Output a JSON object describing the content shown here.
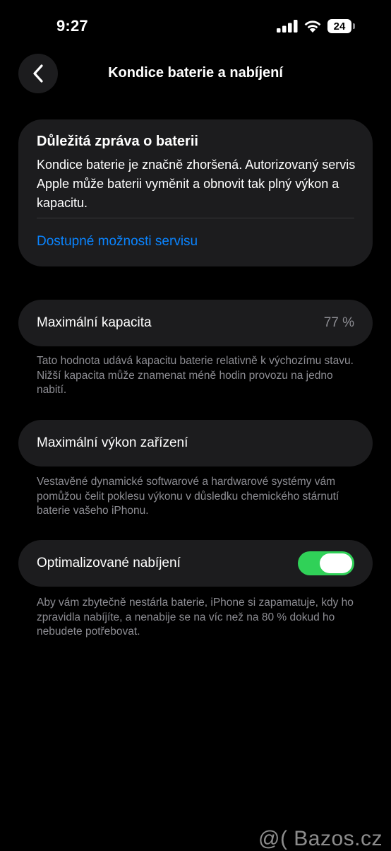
{
  "status_bar": {
    "time": "9:27",
    "battery_level": "24",
    "icons": [
      "signal-icon",
      "wifi-icon",
      "battery-icon"
    ]
  },
  "nav": {
    "back_icon": "chevron-left-icon",
    "title": "Kondice baterie a nabíjení"
  },
  "alert": {
    "title": "Důležitá zpráva o baterii",
    "body": "Kondice baterie je značně zhoršená. Autorizovaný servis Apple může baterii vyměnit a obnovit tak plný výkon a kapacitu.",
    "link": "Dostupné možnosti servisu"
  },
  "capacity": {
    "label": "Maximální kapacita",
    "value": "77 %",
    "footnote": "Tato hodnota udává kapacitu baterie relativně k výchozímu stavu. Nižší kapacita může znamenat méně hodin provozu na jedno nabití."
  },
  "performance": {
    "label": "Maximální výkon zařízení",
    "footnote": "Vestavěné dynamické softwarové a hardwarové systémy vám pomůžou čelit poklesu výkonu v důsledku chemického stárnutí baterie vašeho iPhonu."
  },
  "charging": {
    "label": "Optimalizované nabíjení",
    "toggle_on": true,
    "footnote": "Aby vám zbytečně nestárla baterie, iPhone si zapamatuje, kdy ho zpravidla nabíjíte, a nenabije se na víc než na 80 % dokud ho nebudete potřebovat."
  },
  "watermark": "@( Bazos.cz",
  "colors": {
    "background": "#000000",
    "card": "#1c1c1e",
    "link": "#0a84ff",
    "secondary_text": "#8d8d93",
    "toggle_on": "#30d158"
  }
}
